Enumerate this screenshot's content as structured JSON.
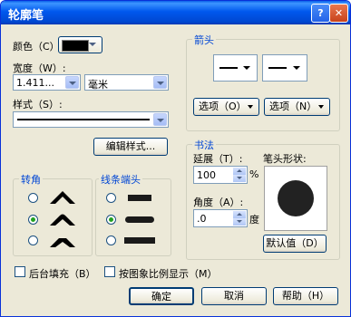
{
  "window": {
    "title": "轮廓笔",
    "help_glyph": "?",
    "close_glyph": "✕"
  },
  "color": {
    "label": "颜色（C）:",
    "value_color": "#000000"
  },
  "width": {
    "label": "宽度（W）:",
    "value": "1.411...",
    "unit": "毫米"
  },
  "style": {
    "label": "样式（S）:"
  },
  "edit_style_button": "编辑样式...",
  "corners": {
    "title": "转角",
    "options": [
      "miter",
      "round",
      "bevel"
    ],
    "selected": 1
  },
  "line_caps": {
    "title": "线条端头",
    "options": [
      "butt",
      "round",
      "square"
    ],
    "selected": 1
  },
  "arrows": {
    "title": "箭头",
    "left_option_button": "选项（O）",
    "right_option_button": "选项（N）"
  },
  "calligraphy": {
    "title": "书法",
    "stretch_label": "延展（T）:",
    "stretch_value": "100",
    "stretch_unit": "%",
    "angle_label": "角度（A）:",
    "angle_value": ".0",
    "angle_unit": "度",
    "nib_label": "笔头形状:",
    "default_button": "默认值（D）"
  },
  "options": {
    "behind_fill": "后台填充（B）",
    "scale_with_image": "按图象比例显示（M）"
  },
  "footer": {
    "ok": "确定",
    "cancel": "取消",
    "help": "帮助（H）"
  }
}
